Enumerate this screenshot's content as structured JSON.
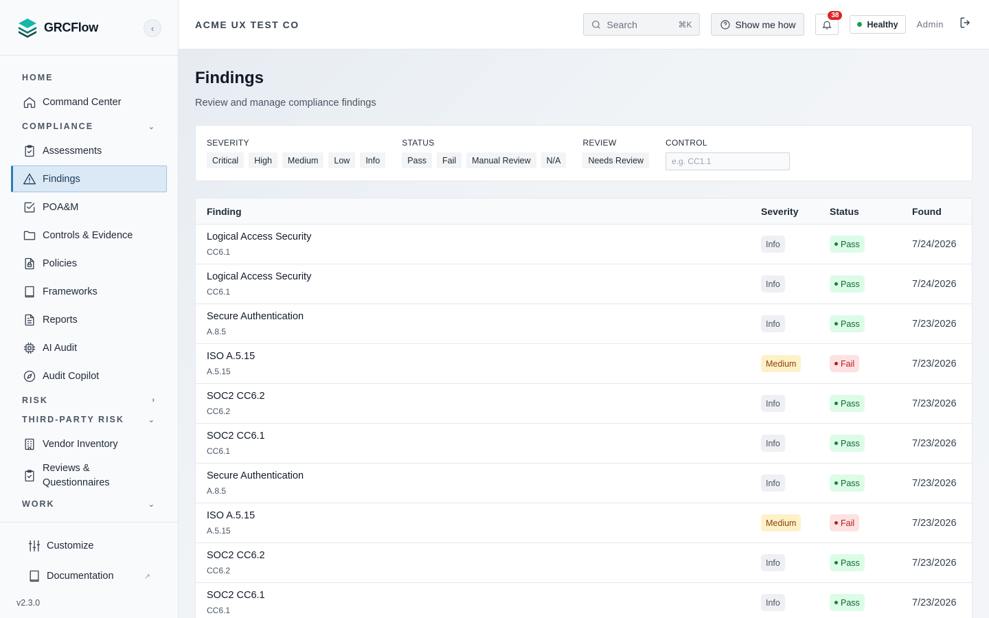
{
  "brand": {
    "name": "GRCFlow",
    "accent": "#0f766e"
  },
  "sidebar": {
    "sections": [
      {
        "label": "HOME",
        "items": [
          "Command Center"
        ]
      },
      {
        "label": "COMPLIANCE",
        "items": [
          "Assessments",
          "Findings",
          "POA&M",
          "Controls & Evidence",
          "Policies",
          "Frameworks",
          "Reports",
          "AI Audit",
          "Audit Copilot"
        ]
      },
      {
        "label": "RISK",
        "items": []
      },
      {
        "label": "THIRD-PARTY RISK",
        "items": [
          "Vendor Inventory",
          "Reviews & Questionnaires"
        ]
      },
      {
        "label": "WORK",
        "items": []
      }
    ],
    "active": "Findings",
    "bottom": {
      "customize": "Customize",
      "documentation": "Documentation"
    },
    "version": "v2.3.0"
  },
  "topbar": {
    "org": "ACME UX TEST CO",
    "search_label": "Search",
    "search_shortcut": "⌘K",
    "howto": "Show me how",
    "notifications": "38",
    "health": "Healthy",
    "health_color": "#16a34a",
    "user": "Admin"
  },
  "page": {
    "title": "Findings",
    "subtitle": "Review and manage compliance findings"
  },
  "filters": {
    "severity": {
      "label": "SEVERITY",
      "options": [
        "Critical",
        "High",
        "Medium",
        "Low",
        "Info"
      ]
    },
    "status": {
      "label": "STATUS",
      "options": [
        "Pass",
        "Fail",
        "Manual Review",
        "N/A"
      ]
    },
    "review": {
      "label": "REVIEW",
      "options": [
        "Needs Review"
      ]
    },
    "control": {
      "label": "CONTROL",
      "placeholder": "e.g. CC1.1"
    }
  },
  "table": {
    "headers": {
      "finding": "Finding",
      "severity": "Severity",
      "status": "Status",
      "found": "Found"
    },
    "rows": [
      {
        "name": "Logical Access Security",
        "control": "CC6.1",
        "severity": "Info",
        "status": "Pass",
        "found": "7/24/2026"
      },
      {
        "name": "Logical Access Security",
        "control": "CC6.1",
        "severity": "Info",
        "status": "Pass",
        "found": "7/24/2026"
      },
      {
        "name": "Secure Authentication",
        "control": "A.8.5",
        "severity": "Info",
        "status": "Pass",
        "found": "7/23/2026"
      },
      {
        "name": "ISO A.5.15",
        "control": "A.5.15",
        "severity": "Medium",
        "status": "Fail",
        "found": "7/23/2026"
      },
      {
        "name": "SOC2 CC6.2",
        "control": "CC6.2",
        "severity": "Info",
        "status": "Pass",
        "found": "7/23/2026"
      },
      {
        "name": "SOC2 CC6.1",
        "control": "CC6.1",
        "severity": "Info",
        "status": "Pass",
        "found": "7/23/2026"
      },
      {
        "name": "Secure Authentication",
        "control": "A.8.5",
        "severity": "Info",
        "status": "Pass",
        "found": "7/23/2026"
      },
      {
        "name": "ISO A.5.15",
        "control": "A.5.15",
        "severity": "Medium",
        "status": "Fail",
        "found": "7/23/2026"
      },
      {
        "name": "SOC2 CC6.2",
        "control": "CC6.2",
        "severity": "Info",
        "status": "Pass",
        "found": "7/23/2026"
      },
      {
        "name": "SOC2 CC6.1",
        "control": "CC6.1",
        "severity": "Info",
        "status": "Pass",
        "found": "7/23/2026"
      }
    ]
  }
}
